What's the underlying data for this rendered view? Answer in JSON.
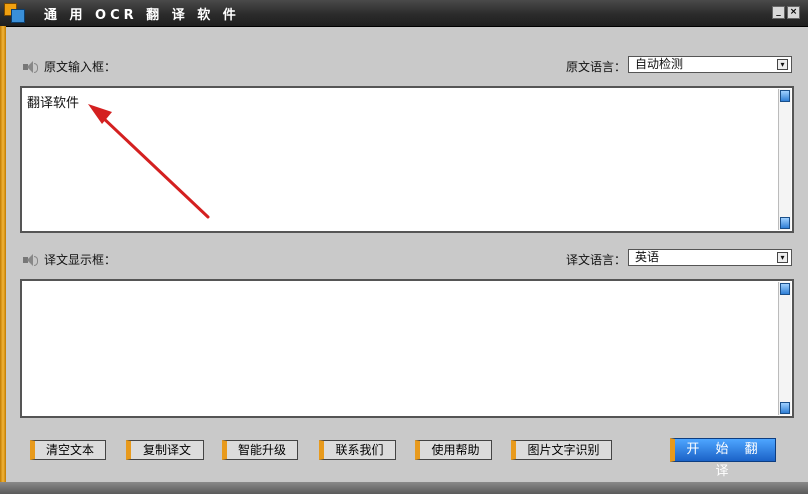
{
  "window": {
    "title": "通 用 OCR 翻 译 软 件",
    "minimize_label": "_",
    "close_label": "×"
  },
  "source": {
    "label": "原文输入框：",
    "language_label": "原文语言：",
    "language_value": "自动检测",
    "text": "翻译软件"
  },
  "target": {
    "label": "译文显示框：",
    "language_label": "译文语言：",
    "language_value": "英语",
    "text": ""
  },
  "buttons": {
    "clear": "清空文本",
    "copy": "复制译文",
    "upgrade": "智能升级",
    "contact": "联系我们",
    "help": "使用帮助",
    "ocr": "图片文字识别",
    "translate": "开 始 翻 译"
  },
  "colors": {
    "accent_orange": "#e89a1c",
    "primary_blue": "#1b62c7",
    "annotation_red": "#d42020"
  },
  "icons": {
    "speaker": "speaker-icon",
    "dropdown": "dropdown-arrow-icon"
  }
}
